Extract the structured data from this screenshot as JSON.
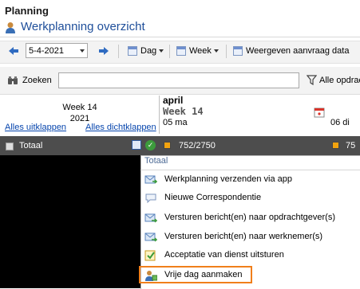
{
  "app": {
    "title": "Planning",
    "subtitle": "Werkplanning overzicht"
  },
  "toolbar": {
    "date_value": "5-4-2021",
    "view_day": "Dag",
    "view_week": "Week",
    "show_requests": "Weergeven aanvraag data"
  },
  "search": {
    "label": "Zoeken",
    "filter_label": "Alle opdrac"
  },
  "grid": {
    "week_label": "Week 14",
    "year_label": "2021",
    "expand_all": "Alles uitklappen",
    "collapse_all": "Alles dichtklappen",
    "month": "april",
    "week_code": "Week 14",
    "day1": "05 ma",
    "day2": "06 di",
    "total_label": "Totaal",
    "total_count": "752/2750",
    "total_count_partial": "75"
  },
  "context_menu": {
    "title": "Totaal",
    "items": [
      {
        "label": "Werkplanning verzenden via app",
        "icon": "send-icon"
      },
      {
        "label": "Nieuwe Correspondentie",
        "icon": "speech-bubble-icon"
      },
      {
        "label": "Versturen bericht(en) naar opdrachtgever(s)",
        "icon": "send-message-icon"
      },
      {
        "label": "Versturen bericht(en) naar werknemer(s)",
        "icon": "send-message-icon"
      },
      {
        "label": "Acceptatie van dienst uitsturen",
        "icon": "accept-service-icon"
      },
      {
        "label": "Vrije dag aanmaken",
        "icon": "person-day-off-icon"
      }
    ]
  },
  "colors": {
    "accent": "#1e4e9a",
    "total_row": "#4d4d4d",
    "highlight": "#f07f1b",
    "status_square": "#f2a30f"
  }
}
